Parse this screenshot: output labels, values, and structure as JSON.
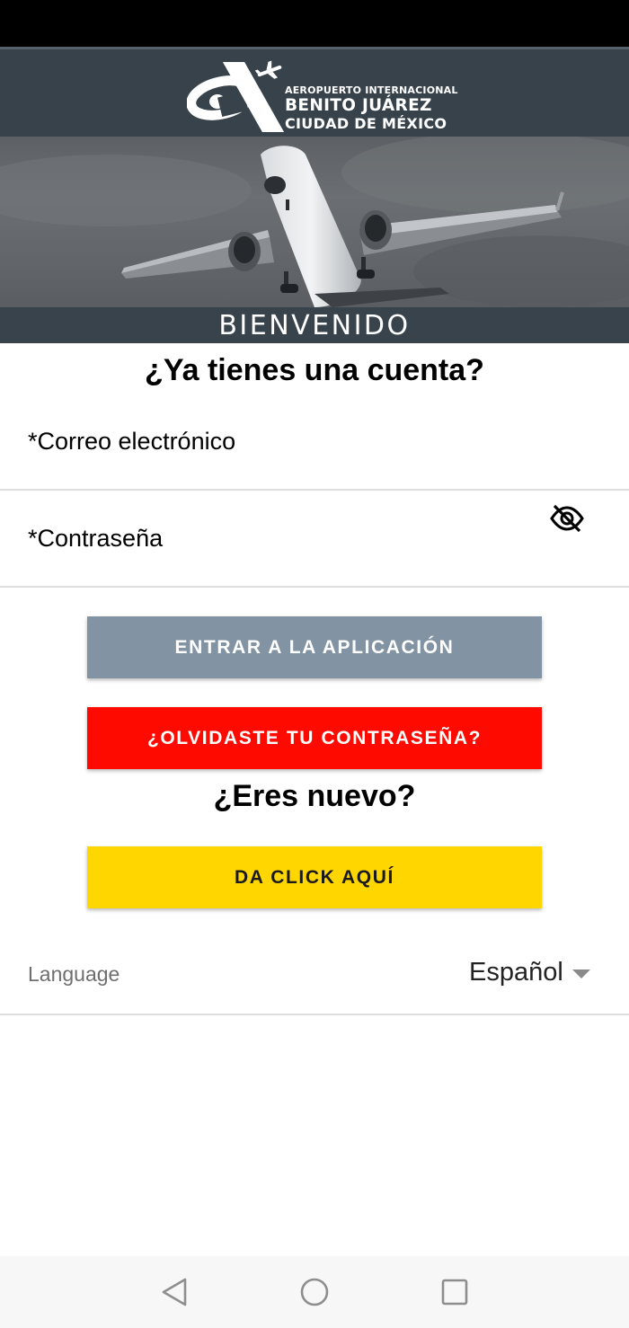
{
  "header": {
    "logo": {
      "line1": "AEROPUERTO INTERNACIONAL",
      "line2": "BENITO JUÁREZ",
      "line3": "CIUDAD DE MÉXICO"
    },
    "welcome": "BIENVENIDO"
  },
  "login": {
    "heading": "¿Ya tienes una cuenta?",
    "email_label": "*Correo electrónico",
    "password_label": "*Contraseña",
    "password_toggle_icon": "eye-off-icon",
    "enter_button": "ENTRAR A LA APLICACIÓN",
    "forgot_button": "¿OLVIDASTE TU CONTRASEÑA?"
  },
  "signup": {
    "heading": "¿Eres nuevo?",
    "button": "DA CLICK AQUÍ"
  },
  "language": {
    "label": "Language",
    "selected": "Español",
    "icon": "caret-down-icon"
  },
  "navigation": {
    "back_icon": "triangle-back-icon",
    "home_icon": "circle-home-icon",
    "recent_icon": "square-recents-icon"
  },
  "colors": {
    "header_bg": "#37424a",
    "enter_button": "#8293a3",
    "forgot_button": "#ff0a00",
    "signup_button": "#ffd600"
  }
}
